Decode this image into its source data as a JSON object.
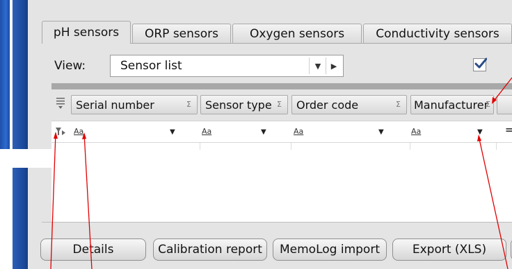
{
  "tabs": [
    {
      "label": "pH sensors",
      "active": true
    },
    {
      "label": "ORP sensors",
      "active": false
    },
    {
      "label": "Oxygen sensors",
      "active": false
    },
    {
      "label": "Conductivity sensors",
      "active": false
    }
  ],
  "view": {
    "label": "View:",
    "selected": "Sensor list",
    "checkbox_checked": true
  },
  "grid": {
    "columns": [
      {
        "label": "Serial number",
        "sum_glyph": "Σ"
      },
      {
        "label": "Sensor type",
        "sum_glyph": "Σ"
      },
      {
        "label": "Order code",
        "sum_glyph": "Σ"
      },
      {
        "label": "Manufacturer",
        "sum_glyph": "Σ"
      }
    ],
    "filter_glyph": "Aa",
    "filter_arrow": "▼",
    "equals_glyph": "="
  },
  "buttons": [
    {
      "label": "Details"
    },
    {
      "label": "Calibration report"
    },
    {
      "label": "MemoLog import"
    },
    {
      "label": "Export (XLS)"
    }
  ],
  "colors": {
    "annotation": "#e00000",
    "sidebar_blue": "#1e4fa8",
    "panel_bg": "#e4e4e4"
  },
  "icons": {
    "rows": "rows-menu-icon",
    "filter": "filter-icon",
    "checkmark": "checkmark-icon"
  }
}
